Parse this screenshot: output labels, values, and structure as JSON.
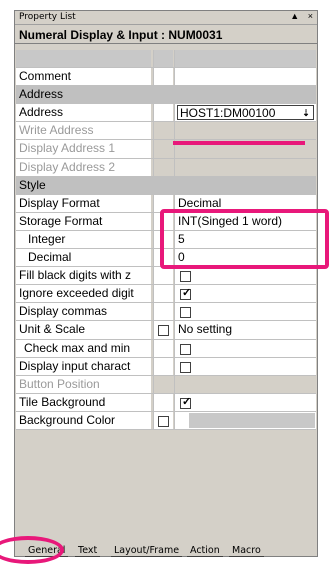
{
  "window": {
    "title": "Property List",
    "pin": "▲",
    "close": "×"
  },
  "header": {
    "title": "Numeral Display & Input : NUM0031"
  },
  "rows": [
    {
      "label": "",
      "type": "empty"
    },
    {
      "label": "Comment",
      "value": ""
    },
    {
      "label": "Address",
      "type": "section"
    },
    {
      "label": "Address",
      "value": "HOST1:DM00100",
      "control": "address-picker",
      "button_glyph": "⇣"
    },
    {
      "label": "Write Address",
      "type": "disabled"
    },
    {
      "label": "Display Address 1",
      "type": "disabled"
    },
    {
      "label": "Display Address 2",
      "type": "disabled"
    },
    {
      "label": "Style",
      "type": "section"
    },
    {
      "label": "Display Format",
      "value": "Decimal"
    },
    {
      "label": "Storage Format",
      "value": "INT(Singed 1 word)"
    },
    {
      "label": "Integer",
      "value": "5",
      "indent": true
    },
    {
      "label": "Decimal",
      "value": "0",
      "indent": true
    },
    {
      "label": "Fill black digits with z",
      "checked": false
    },
    {
      "label": "Ignore exceeded digit",
      "checked": true
    },
    {
      "label": "Display commas",
      "checked": false
    },
    {
      "label": "Unit & Scale",
      "value": "No setting",
      "row_checkbox": true
    },
    {
      "label": "Check max and min",
      "checked": false,
      "indent2": true
    },
    {
      "label": "Display input charact",
      "checked": false
    },
    {
      "label": "Button Position",
      "type": "disabled"
    },
    {
      "label": "Tile Background",
      "checked": true
    },
    {
      "label": "Background Color",
      "color_swatch": "#c8c8c8",
      "row_checkbox": true
    }
  ],
  "tabs": [
    "General",
    "Text",
    "Layout/Frame",
    "Action",
    "Macro"
  ],
  "active_tab": "General",
  "highlight_color": "#e8187a"
}
